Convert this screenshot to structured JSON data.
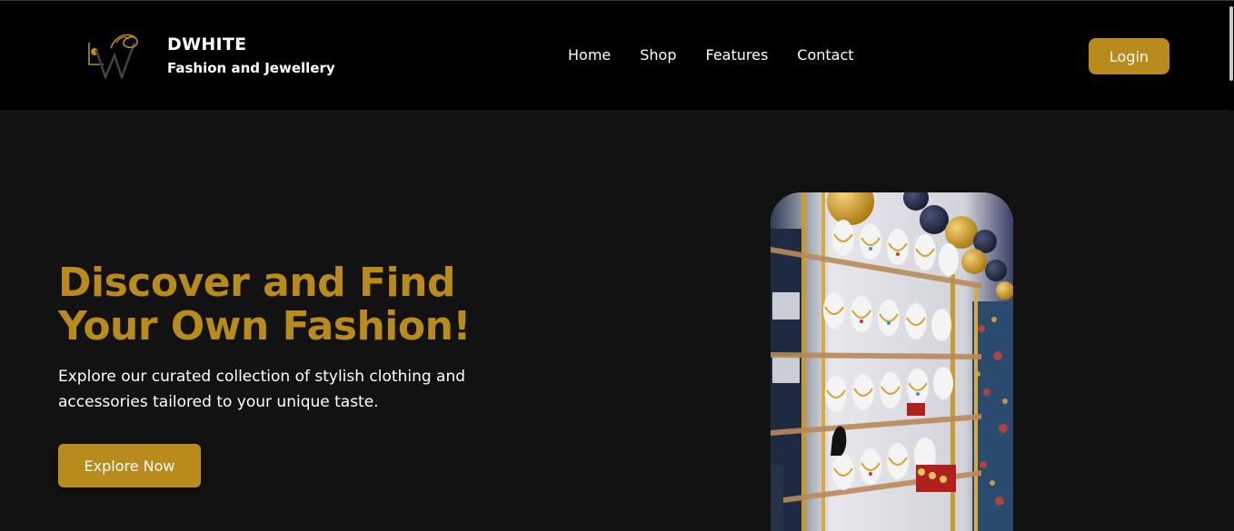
{
  "brand": {
    "name": "DWHITE",
    "tagline": "Fashion and Jewellery",
    "logo_icon": "dw-monogram-icon"
  },
  "nav": {
    "links": [
      "Home",
      "Shop",
      "Features",
      "Contact"
    ],
    "login_label": "Login"
  },
  "hero": {
    "title": "Discover and Find Your Own Fashion!",
    "subtitle": "Explore our curated collection of stylish clothing and accessories tailored to your unique taste.",
    "cta_label": "Explore Now",
    "image_icon": "jewellery-store-display-image"
  },
  "colors": {
    "accent": "#b98b1d",
    "nav_background": "#000000",
    "page_background": "#121212",
    "text": "#ffffff"
  }
}
